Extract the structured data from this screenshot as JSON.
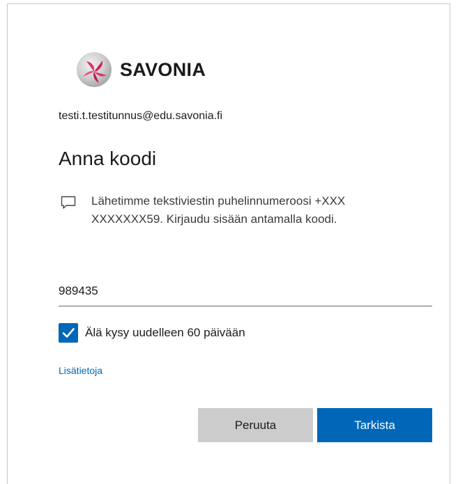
{
  "logo": {
    "text": "SAVONIA",
    "icon": "savonia-logo-icon"
  },
  "identity": {
    "email": "testi.t.testitunnus@edu.savonia.fi"
  },
  "title": "Anna koodi",
  "message": {
    "icon": "sms-message-icon",
    "text": "Lähetimme tekstiviestin puhelinnumeroosi +XXX XXXXXXX59. Kirjaudu sisään antamalla koodi."
  },
  "code_input": {
    "value": "989435"
  },
  "remember": {
    "checked": true,
    "label": "Älä kysy uudelleen 60 päivään"
  },
  "more_info_link": "Lisätietoja",
  "buttons": {
    "cancel": "Peruuta",
    "verify": "Tarkista"
  },
  "colors": {
    "accent": "#0067b8",
    "cancel_bg": "#cccccc",
    "logo_pink": "#e0336e"
  }
}
